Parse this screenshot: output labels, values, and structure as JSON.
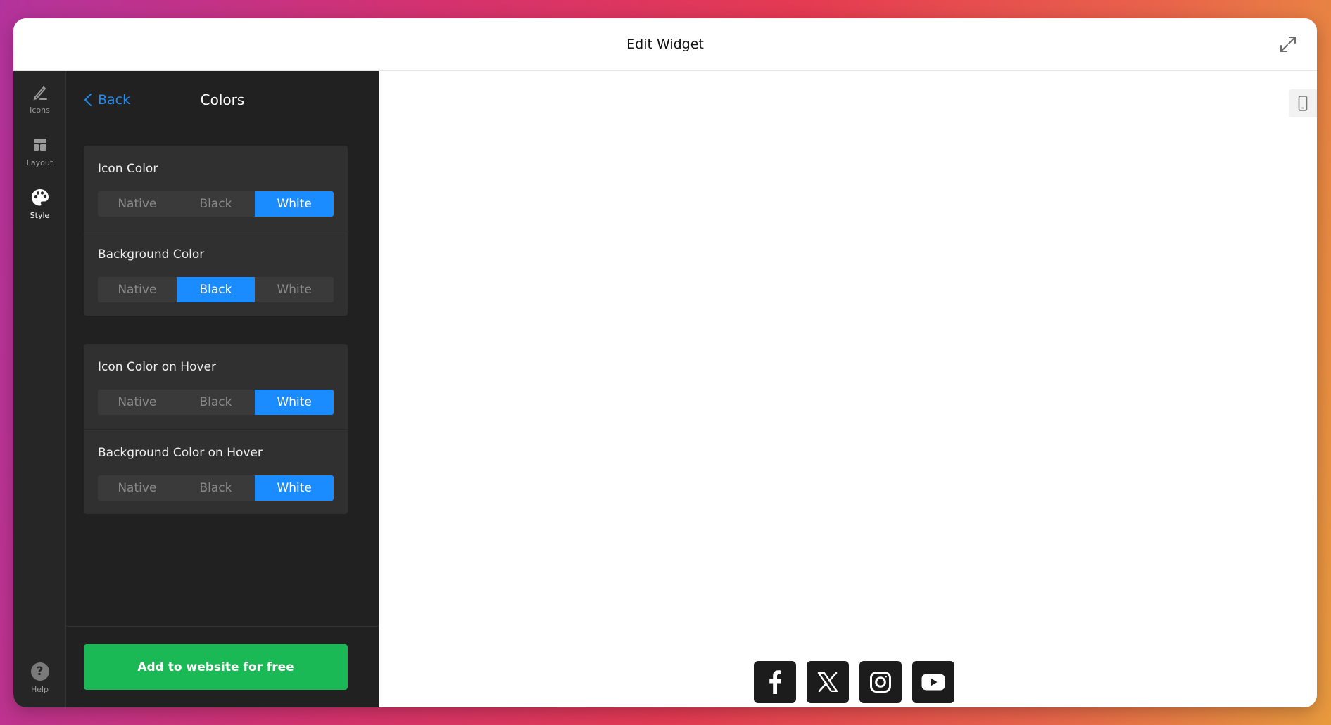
{
  "window": {
    "title": "Edit Widget"
  },
  "rail": {
    "items": [
      {
        "label": "Icons",
        "icon": "pencil-icon"
      },
      {
        "label": "Layout",
        "icon": "layout-icon"
      },
      {
        "label": "Style",
        "icon": "palette-icon",
        "active": true
      }
    ],
    "help_label": "Help"
  },
  "panel": {
    "back_label": "Back",
    "title": "Colors",
    "settings": [
      {
        "label": "Icon Color",
        "options": [
          "Native",
          "Black",
          "White"
        ],
        "selected": "White"
      },
      {
        "label": "Background Color",
        "options": [
          "Native",
          "Black",
          "White"
        ],
        "selected": "Black"
      },
      {
        "label": "Icon Color on Hover",
        "options": [
          "Native",
          "Black",
          "White"
        ],
        "selected": "White"
      },
      {
        "label": "Background Color on Hover",
        "options": [
          "Native",
          "Black",
          "White"
        ],
        "selected": "White"
      }
    ],
    "cta_label": "Add to website for free"
  },
  "preview": {
    "social_icons": [
      "facebook-icon",
      "x-icon",
      "instagram-icon",
      "youtube-icon"
    ]
  },
  "colors": {
    "accent": "#1a8cff",
    "cta": "#1bb955",
    "panel_bg": "#212121",
    "rail_bg": "#262626"
  }
}
